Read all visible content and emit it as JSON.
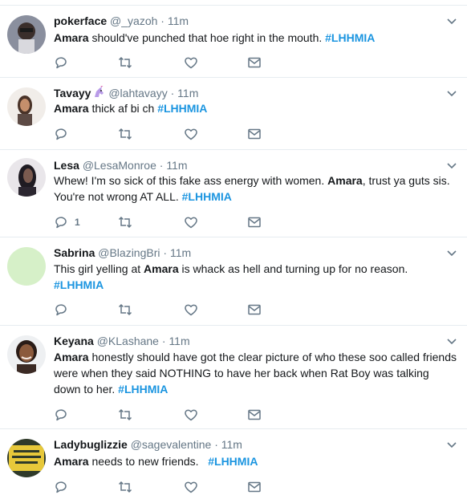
{
  "tweets": [
    {
      "name": "pokerface",
      "handle": "@_yazoh",
      "time": "11m",
      "text_before": "",
      "mention": "Amara",
      "text_after": " should've punched that hoe right in the mouth. ",
      "hashtag": "#LHHMIA",
      "reply_count": ""
    },
    {
      "name": "Tavayy",
      "handle": "@lahtavayy",
      "time": "11m",
      "mention": "Amara",
      "text_after": " thick af bi  ch ",
      "hashtag": "#LHHMIA",
      "reply_count": ""
    },
    {
      "name": "Lesa",
      "handle": "@LesaMonroe",
      "time": "11m",
      "text_before": "Whew! I'm so sick of this fake ass energy with women. ",
      "mention": "Amara",
      "text_after": ", trust ya guts sis. You're not wrong AT ALL. ",
      "hashtag": "#LHHMIA",
      "reply_count": "1"
    },
    {
      "name": "Sabrina",
      "handle": "@BlazingBri",
      "time": "11m",
      "text_before": "This girl yelling at ",
      "mention": "Amara",
      "text_after": " is whack as hell and turning up for no reason.",
      "hashtag": "#LHHMIA",
      "reply_count": ""
    },
    {
      "name": "Keyana",
      "handle": "@KLashane",
      "time": "11m",
      "mention": "Amara",
      "text_after": " honestly should have got the clear picture of who these soo called friends were when they said NOTHING to have her back when Rat Boy was talking down to her. ",
      "hashtag": "#LHHMIA",
      "reply_count": ""
    },
    {
      "name": "Ladybuglizzie",
      "handle": "@sagevalentine",
      "time": "11m",
      "mention": "Amara",
      "text_after": " needs to new friends.   ",
      "hashtag": "#LHHMIA",
      "reply_count": ""
    }
  ],
  "dot": "·",
  "colors": {
    "link": "#1b95e0",
    "muted": "#657786",
    "border": "#e6ecf0"
  }
}
